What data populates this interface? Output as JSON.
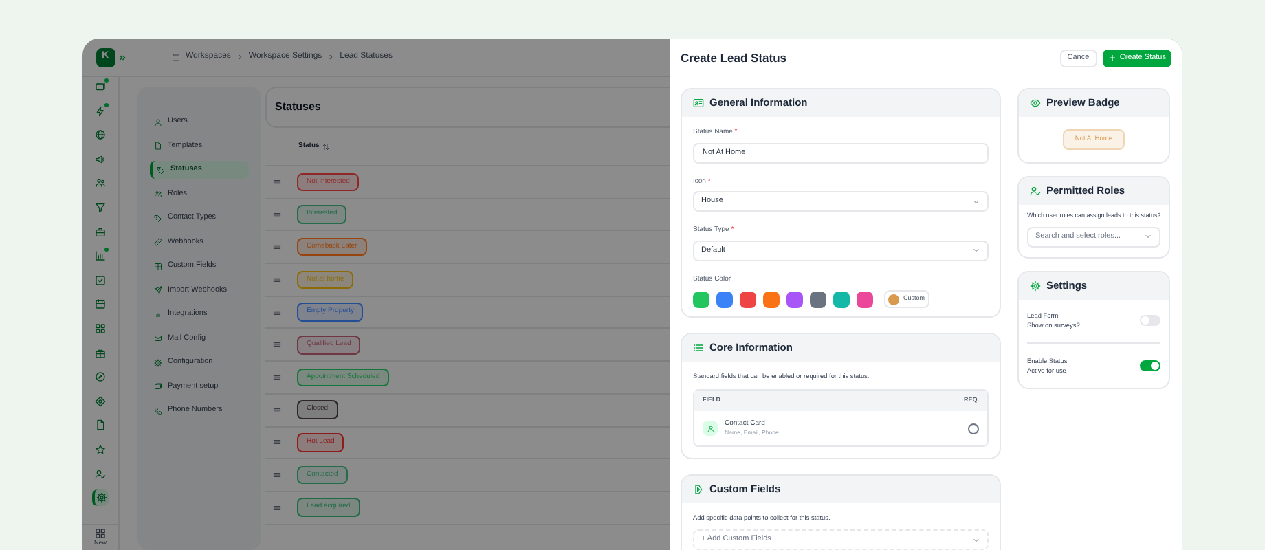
{
  "app": {
    "logo": "K",
    "breadcrumb": [
      "Workspaces",
      "Workspace Settings",
      "Lead Statuses"
    ],
    "rail": [
      {
        "selected": false,
        "badge": true
      },
      {
        "selected": false,
        "badge": true
      },
      {
        "selected": false,
        "badge": false
      },
      {
        "selected": false,
        "badge": false
      },
      {
        "selected": false,
        "badge": false
      },
      {
        "selected": false,
        "badge": false
      },
      {
        "selected": false,
        "badge": false
      },
      {
        "selected": false,
        "badge": true
      },
      {
        "selected": false,
        "badge": false
      },
      {
        "selected": false,
        "badge": false
      },
      {
        "selected": false,
        "badge": false
      },
      {
        "selected": false,
        "badge": false
      },
      {
        "selected": false,
        "badge": false
      },
      {
        "selected": false,
        "badge": false
      },
      {
        "selected": false,
        "badge": false
      },
      {
        "selected": false,
        "badge": false
      },
      {
        "selected": false,
        "badge": false
      },
      {
        "selected": true,
        "badge": false
      }
    ],
    "rail_new_label": "New",
    "settings_nav": [
      {
        "label": "Users",
        "selected": false
      },
      {
        "label": "Templates",
        "selected": false
      },
      {
        "label": "Statuses",
        "selected": true
      },
      {
        "label": "Roles",
        "selected": false
      },
      {
        "label": "Contact Types",
        "selected": false
      },
      {
        "label": "Webhooks",
        "selected": false
      },
      {
        "label": "Custom Fields",
        "selected": false
      },
      {
        "label": "Import Webhooks",
        "selected": false
      },
      {
        "label": "Integrations",
        "selected": false
      },
      {
        "label": "Mail Config",
        "selected": false
      },
      {
        "label": "Configuration",
        "selected": false
      },
      {
        "label": "Payment setup",
        "selected": false
      },
      {
        "label": "Phone Numbers",
        "selected": false
      }
    ],
    "statuses": {
      "title": "Statuses",
      "column": "Status",
      "rows": [
        {
          "label": "Not Interested",
          "color": "#8f2929"
        },
        {
          "label": "Interested",
          "color": "#236b49"
        },
        {
          "label": "Comeback Later",
          "color": "#95450d"
        },
        {
          "label": "Not at home",
          "color": "#8c6b05"
        },
        {
          "label": "Empty Property",
          "color": "#234e94"
        },
        {
          "label": "Qualified Lead",
          "color": "#6e3742"
        },
        {
          "label": "Appointment Scheduled",
          "color": "#147638"
        },
        {
          "label": "Closed",
          "color": "#2d2626"
        },
        {
          "label": "Hot Lead",
          "color": "#8f1a1a"
        },
        {
          "label": "Contacted",
          "color": "#236b49"
        },
        {
          "label": "Lead acquired",
          "color": "#1d6a43"
        }
      ]
    }
  },
  "modal": {
    "title": "Create Lead Status",
    "cancel": "Cancel",
    "create": "Create Status",
    "general": {
      "title": "General Information",
      "fields": [
        {
          "kind": "input",
          "label": "Status Name",
          "required_mark": "*",
          "value": "Not At Home"
        },
        {
          "kind": "select",
          "label": "Icon",
          "required_mark": "*",
          "value": "House"
        },
        {
          "kind": "select",
          "label": "Status Type",
          "required_mark": "*",
          "value": "Default"
        }
      ],
      "color_label": "Status Color",
      "swatches": [
        {
          "color": "#22c55e"
        },
        {
          "color": "#3b82f6"
        },
        {
          "color": "#ef4444"
        },
        {
          "color": "#f97316"
        },
        {
          "color": "#a855f7"
        },
        {
          "color": "#6b7280"
        },
        {
          "color": "#14b8a6"
        },
        {
          "color": "#ec4899"
        }
      ],
      "custom": {
        "label": "Custom",
        "color": "#d99a4e"
      }
    },
    "core": {
      "title": "Core Information",
      "description": "Standard fields that can be enabled or required for this status.",
      "columns": [
        "FIELD",
        "REQ."
      ],
      "rows": [
        {
          "name": "Contact Card",
          "detail": "Name, Email, Phone",
          "checked": false
        }
      ]
    },
    "custom_fields": {
      "title": "Custom Fields",
      "description": "Add specific data points to collect for this status.",
      "placeholder": "+ Add Custom Fields"
    },
    "preview": {
      "title": "Preview Badge",
      "badge": "Not At Home",
      "color": "#d99a4e"
    },
    "roles": {
      "title": "Permitted Roles",
      "description": "Which user roles can assign leads to this status?",
      "placeholder": "Search and select roles..."
    },
    "settings": {
      "title": "Settings",
      "items": [
        {
          "label": "Lead Form",
          "detail": "Show on surveys?",
          "on": false
        },
        {
          "label": "Enable Status",
          "detail": "Active for use",
          "on": true
        }
      ]
    }
  }
}
